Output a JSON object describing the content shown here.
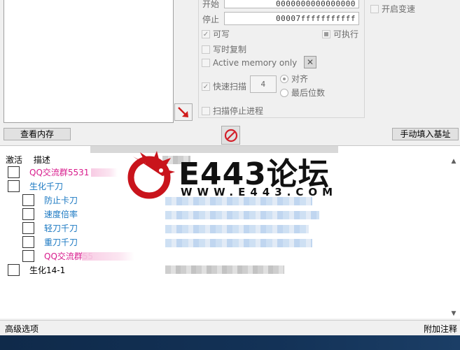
{
  "scan_options": {
    "start_label": "开始",
    "start_value": "0000000000000000",
    "stop_label": "停止",
    "stop_value": "00007fffffffffff",
    "writable_label": "可写",
    "executable_label": "可执行",
    "copy_on_write_label": "写时复制",
    "active_memory_label": "Active memory only",
    "fast_scan_label": "快速扫描",
    "fast_scan_value": "4",
    "align_label": "对齐",
    "last_digits_label": "最后位数",
    "pause_game_label": "扫描停止进程",
    "enable_speedhack_label": "开启变速"
  },
  "buttons": {
    "memory_view": "查看内存",
    "add_address_manually": "手动填入基址"
  },
  "address_list": {
    "col_active": "激活",
    "col_description": "描述",
    "items": [
      {
        "label": "QQ交流群5531",
        "color": "#d81b8c",
        "indent": 0
      },
      {
        "label": "生化千刀",
        "color": "#1a78c2",
        "indent": 0
      },
      {
        "label": "防止卡刀",
        "color": "#1a78c2",
        "indent": 1
      },
      {
        "label": "速度倍率",
        "color": "#1a78c2",
        "indent": 1
      },
      {
        "label": "轻刀千刀",
        "color": "#1a78c2",
        "indent": 1
      },
      {
        "label": "重刀千刀",
        "color": "#1a78c2",
        "indent": 1
      },
      {
        "label": "QQ交流群55",
        "color": "#d81b8c",
        "indent": 1
      },
      {
        "label": "生化14-1",
        "color": "#000000",
        "indent": 0
      }
    ]
  },
  "status_bar": {
    "advanced_options": "高级选项",
    "table_extras": "附加注释"
  },
  "watermark": {
    "title": "E443论坛",
    "subtitle": "WWW.E443.COM"
  },
  "icons": {
    "arrow": "red-diagonal-arrow-icon",
    "stop": "prohibited-icon",
    "close": "close-icon",
    "dragon": "dragon-logo"
  }
}
